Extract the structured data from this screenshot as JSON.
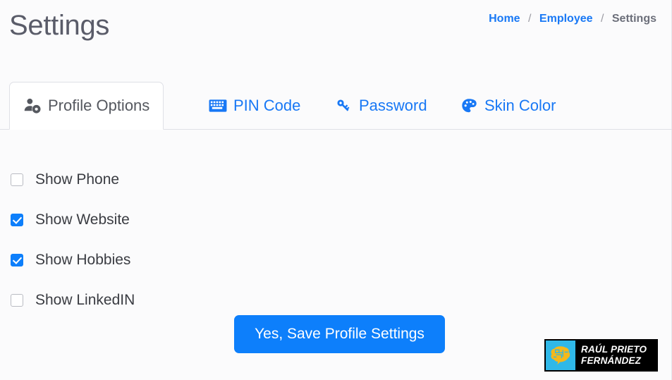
{
  "header": {
    "title": "Settings",
    "breadcrumb": {
      "separator": "/",
      "items": [
        {
          "label": "Home",
          "current": false
        },
        {
          "label": "Employee",
          "current": false
        },
        {
          "label": "Settings",
          "current": true
        }
      ]
    }
  },
  "tabs": [
    {
      "label": "Profile Options",
      "icon": "user-cog-icon",
      "active": true
    },
    {
      "label": "PIN Code",
      "icon": "keyboard-icon",
      "active": false
    },
    {
      "label": "Password",
      "icon": "key-icon",
      "active": false
    },
    {
      "label": "Skin Color",
      "icon": "palette-icon",
      "active": false
    }
  ],
  "options": [
    {
      "label": "Show Phone",
      "checked": false
    },
    {
      "label": "Show Website",
      "checked": true
    },
    {
      "label": "Show Hobbies",
      "checked": true
    },
    {
      "label": "Show LinkedIN",
      "checked": false
    }
  ],
  "save_button": {
    "label": "Yes, Save Profile Settings"
  },
  "watermark": {
    "line1": "RAÚL PRIETO",
    "line2": "FERNÁNDEZ",
    "logo": "brain-circuit-icon"
  },
  "colors": {
    "accent_blue": "#0d7ffb",
    "link_blue": "#1878f5",
    "title_gray": "#5a5c69",
    "text_gray": "#3a3c42",
    "page_bg": "#fbfbfc",
    "border_gray": "#dfe0e6",
    "badge_bg": "#000000",
    "badge_logo_bg": "#2fb8e8",
    "badge_logo_fg": "#f5b81a"
  }
}
